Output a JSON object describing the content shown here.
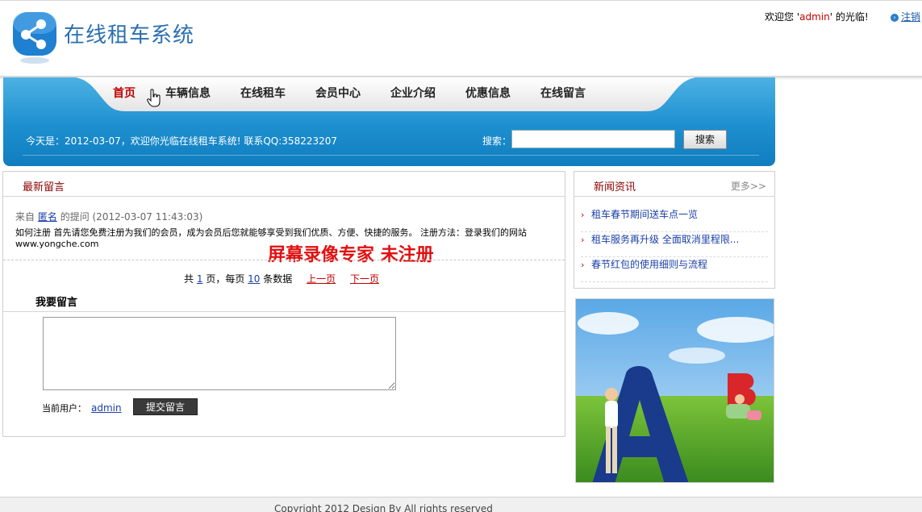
{
  "header": {
    "site_title": "在线租车系统",
    "welcome_prefix": "欢迎您 '",
    "username": "admin",
    "welcome_suffix": "' 的光临!",
    "logout_label": "注销"
  },
  "nav": {
    "items": [
      "首页",
      "车辆信息",
      "在线租车",
      "会员中心",
      "企业介绍",
      "优惠信息",
      "在线留言"
    ],
    "active_index": 0
  },
  "banner": {
    "today_text": "今天是：2012-03-07，欢迎你光临在线租车系统! 联系QQ:358223207",
    "search_label": "搜索：",
    "search_value": "",
    "search_button": "搜索"
  },
  "messages": {
    "title": "最新留言",
    "meta_from": "来自",
    "author": "匿名",
    "meta_rest": "的提问 (2012-03-07 11:43:03)",
    "body": "如何注册 首先请您免费注册为我们的会员，成为会员后您就能够享受到我们优质、方便、快捷的服务。 注册方法：登录我们的网站www.yongche.com",
    "watermark": "屏幕录像专家  未注册",
    "pager": {
      "prefix": "共",
      "total_pages": "1",
      "middle": "页，每页",
      "per_page": "10",
      "suffix": "条数据",
      "prev": "上一页",
      "next": "下一页"
    },
    "leave_title": "我要留言",
    "textarea_value": "",
    "current_user_label": "当前用户：",
    "current_user": "admin",
    "submit_label": "提交留言"
  },
  "news": {
    "title": "新闻资讯",
    "more": "更多>>",
    "items": [
      "租车春节期间送车点一览",
      "租车服务再升级 全面取消里程限...",
      "春节红包的使用细则与流程"
    ]
  },
  "footer": {
    "copyright": "Copyright 2012 Design By All rights reserved"
  },
  "colors": {
    "brand_blue": "#2a6fb0",
    "banner_blue": "#1d8fcf",
    "accent_red": "#c00000",
    "link_blue": "#1a3fa8"
  }
}
